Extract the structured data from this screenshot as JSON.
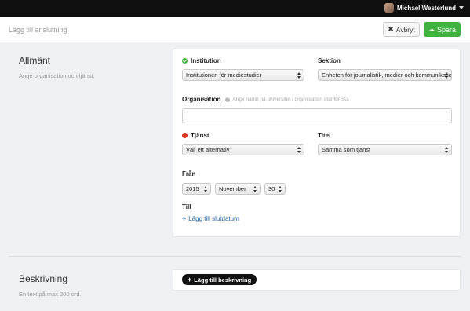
{
  "topbar": {
    "user_name": "Michael Westerlund"
  },
  "header": {
    "title": "Lägg till anslutning",
    "cancel_label": "Avbryt",
    "save_label": "Spara"
  },
  "sections": {
    "general": {
      "title": "Allmänt",
      "description": "Ange organisation och tjänst."
    },
    "description": {
      "title": "Beskrivning",
      "description": "En text på max 200 ord."
    }
  },
  "form": {
    "institution": {
      "label": "Institution",
      "value": "Institutionen för mediestudier",
      "status": "valid"
    },
    "section": {
      "label": "Sektion",
      "value": "Enheten för journalistik, medier och kommunikation"
    },
    "organisation": {
      "label": "Organisation",
      "hint": "Ange namn på universitet / organisation utanför SU.",
      "value": ""
    },
    "service": {
      "label": "Tjänst",
      "value": "Välj ett alternativ",
      "status": "required"
    },
    "title": {
      "label": "Titel",
      "value": "Samma som tjänst"
    },
    "from": {
      "label": "Från",
      "year": "2015",
      "month": "November",
      "day": "30"
    },
    "to": {
      "label": "Till",
      "add_end_date": "Lägg till slutdatum"
    },
    "add_description": "Lägg till beskrivning"
  },
  "colors": {
    "accent_green": "#3fb23f",
    "required_red": "#e0301e",
    "link_blue": "#1f5fa8"
  }
}
